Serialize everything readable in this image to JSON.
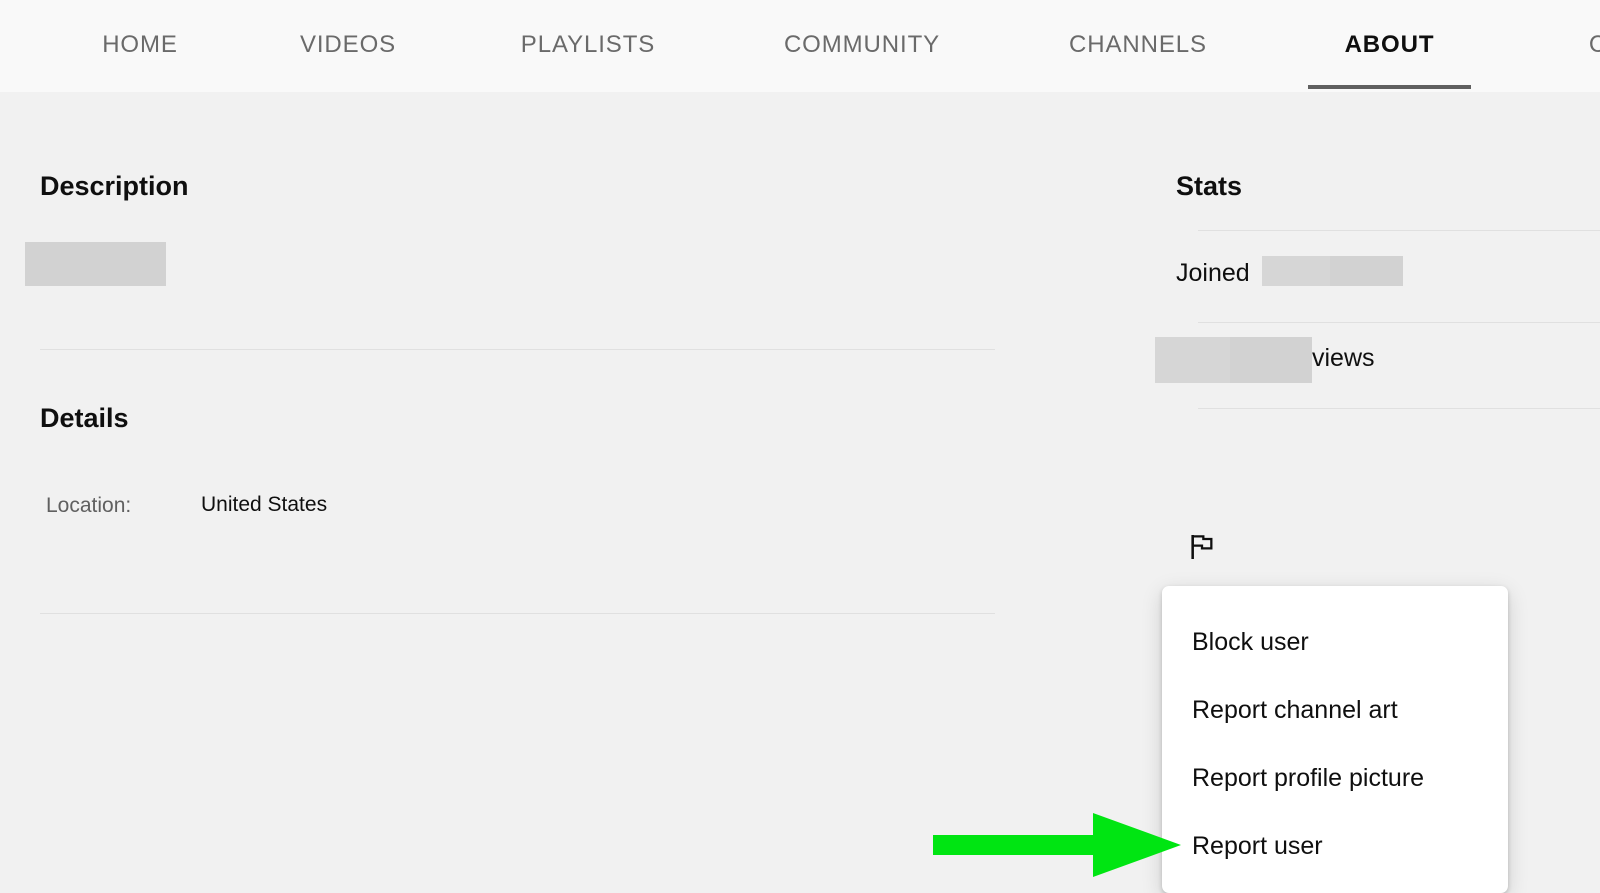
{
  "colors": {
    "header_bg": "#f9f9f9",
    "page_bg": "#f1f1f1",
    "menu_bg": "#ffffff",
    "text_primary": "#0f0f0f",
    "text_secondary": "#606060",
    "divider": "#e0e0e0",
    "redaction": "#d2d2d2",
    "annotation_green": "#00e512",
    "active_tab_underline": "#606060"
  },
  "tabs": [
    {
      "label": "HOME",
      "active": false
    },
    {
      "label": "VIDEOS",
      "active": false
    },
    {
      "label": "PLAYLISTS",
      "active": false
    },
    {
      "label": "COMMUNITY",
      "active": false
    },
    {
      "label": "CHANNELS",
      "active": false
    },
    {
      "label": "ABOUT",
      "active": true
    },
    {
      "label": "C",
      "active": false
    }
  ],
  "main": {
    "description": {
      "heading": "Description",
      "body_redacted": true
    },
    "details": {
      "heading": "Details",
      "rows": [
        {
          "label": "Location:",
          "value": "United States"
        }
      ]
    }
  },
  "stats": {
    "heading": "Stats",
    "joined_label": "Joined",
    "joined_value_redacted": true,
    "views_label": "views",
    "views_value_redacted": true
  },
  "report_menu": {
    "trigger_icon": "flag-icon",
    "items": [
      {
        "label": "Block user"
      },
      {
        "label": "Report channel art"
      },
      {
        "label": "Report profile picture"
      },
      {
        "label": "Report user",
        "highlighted": true
      }
    ]
  },
  "annotation": {
    "type": "arrow",
    "direction": "right",
    "points_to": "Report user",
    "color": "#00e512"
  }
}
